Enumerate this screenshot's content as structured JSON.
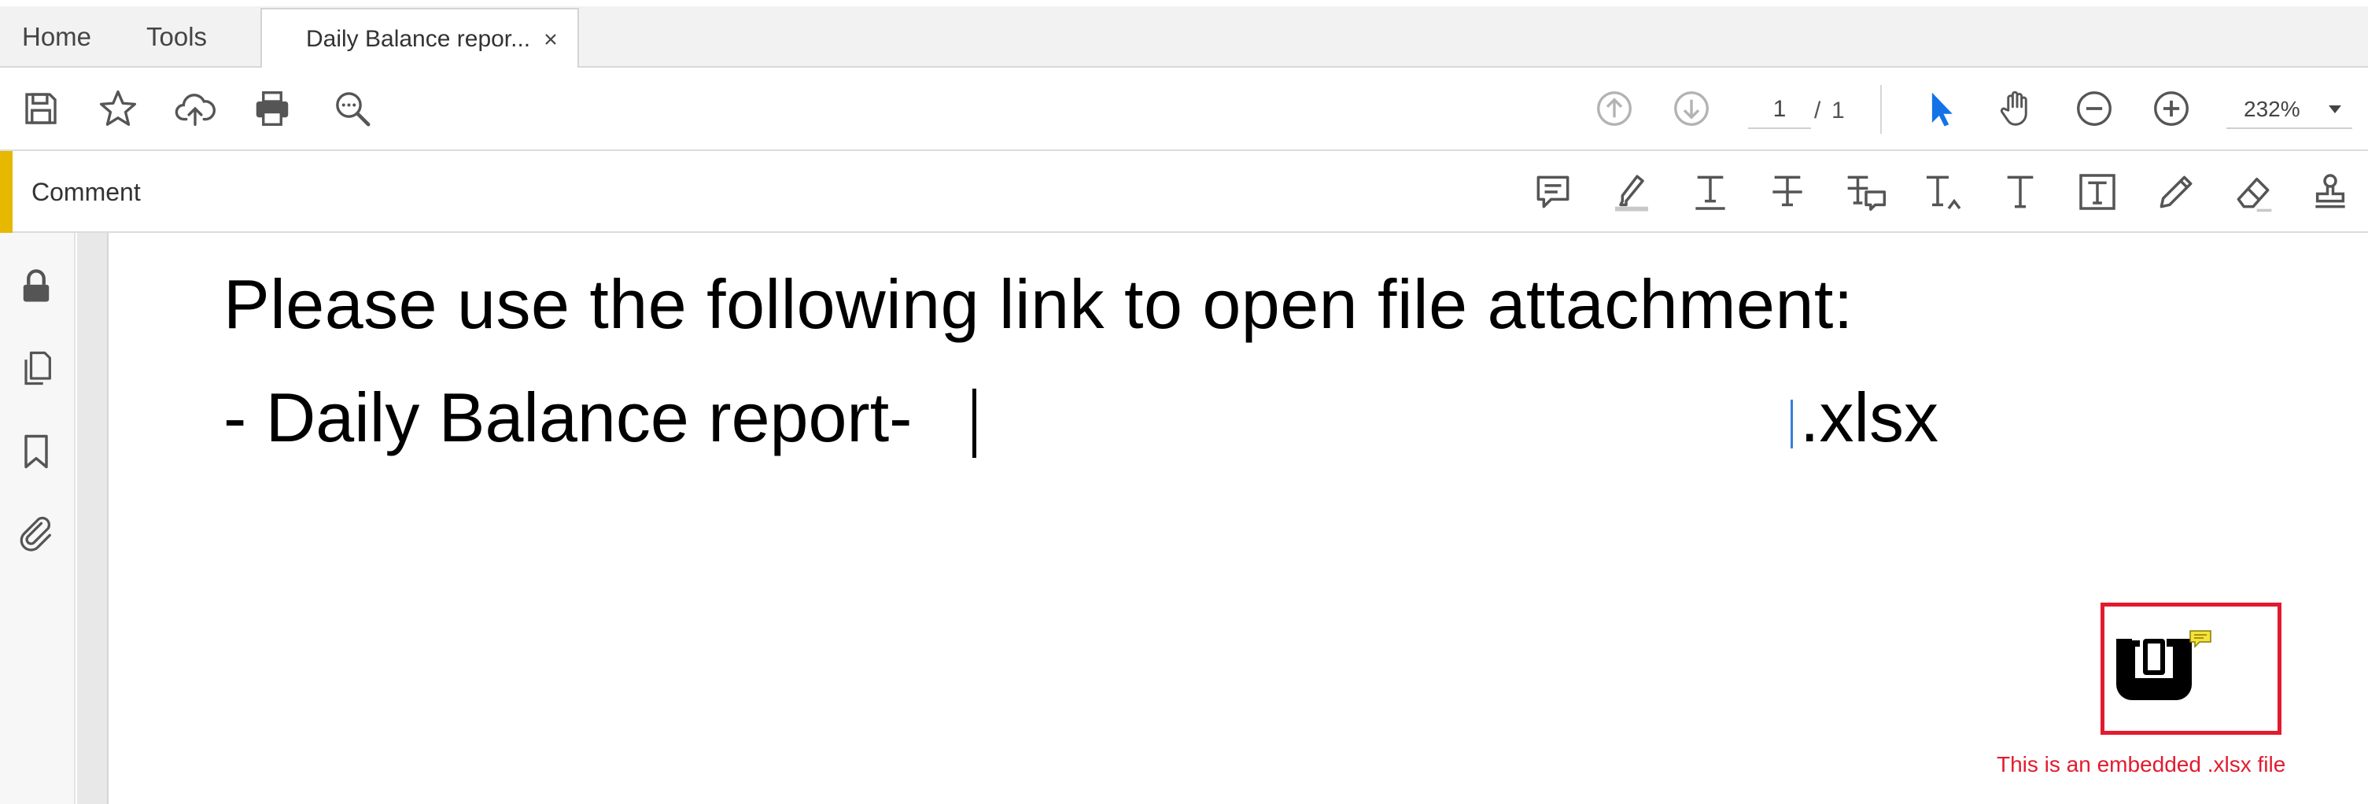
{
  "tabs": {
    "home": "Home",
    "tools": "Tools",
    "document": "Daily Balance repor..."
  },
  "toolbar": {
    "page_current": "1",
    "page_separator": "/",
    "page_total": "1",
    "zoom": "232%"
  },
  "comment_bar": {
    "title": "Comment"
  },
  "document": {
    "line1": "Please use the following link to open file attachment:",
    "line2_prefix": "- Daily Balance report-",
    "line2_suffix": ".xlsx",
    "attachment_caption": "This is an embedded .xlsx file"
  },
  "colors": {
    "accent_yellow": "#e6b800",
    "annotation_red": "#e21b2e",
    "select_blue": "#1473e6"
  }
}
